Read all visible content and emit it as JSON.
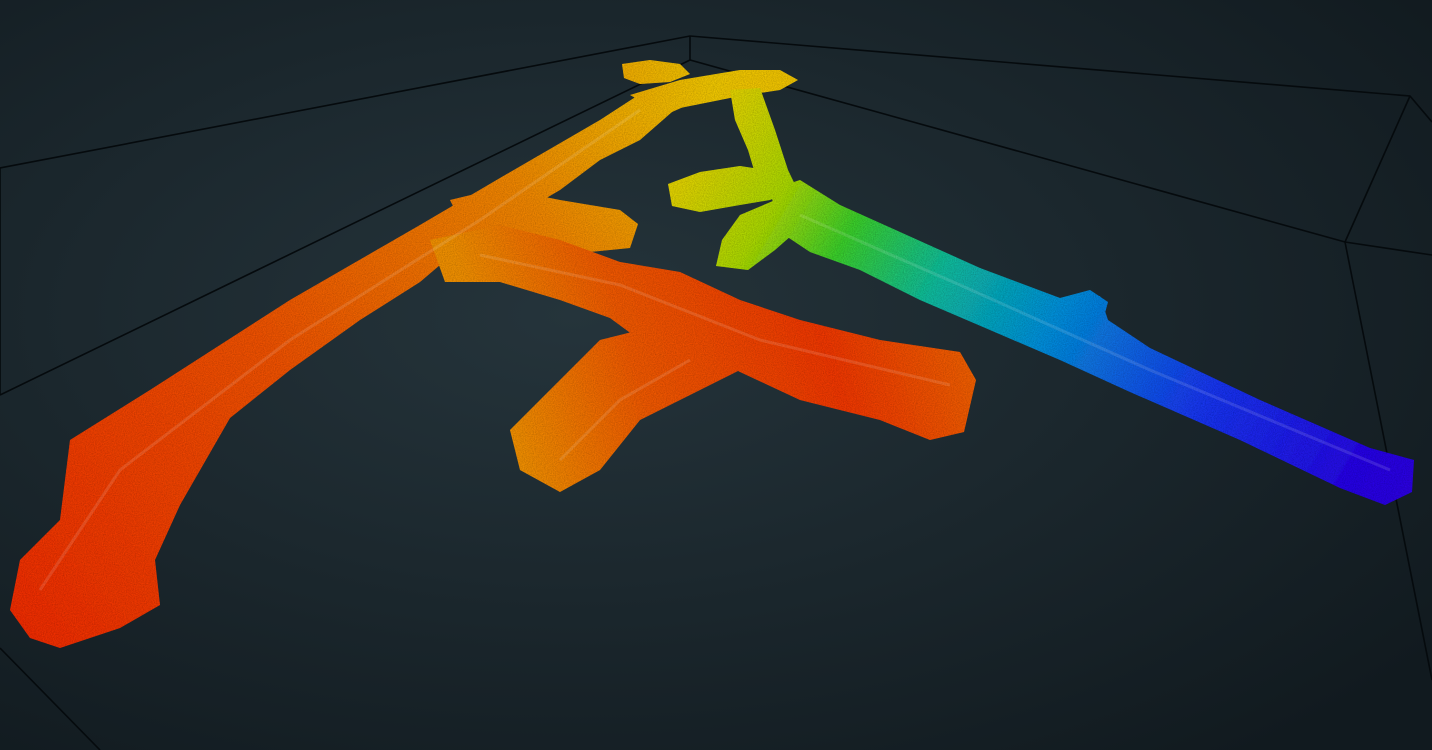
{
  "scene": {
    "background_center": "#25343b",
    "background_edge": "#111a1f",
    "bounding_box_color": "#050a0d",
    "point_cloud_colormap": [
      "#ff2600",
      "#ff6a00",
      "#ffb000",
      "#f2e600",
      "#7ee21a",
      "#18d06a",
      "#10b4d2",
      "#1461ff",
      "#2c00ff"
    ],
    "icons": [
      "point-cloud-tunnel-map"
    ]
  }
}
